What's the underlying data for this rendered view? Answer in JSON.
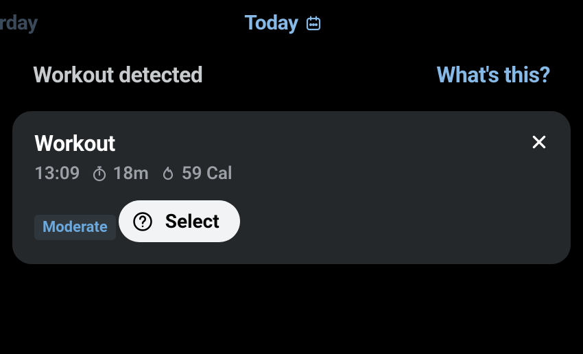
{
  "tabs": {
    "prev_visible_label": "sterday",
    "current_label": "Today"
  },
  "section": {
    "title": "Workout detected",
    "help_link": "What's this?"
  },
  "card": {
    "title": "Workout",
    "time": "13:09",
    "duration": "18m",
    "calories": "59 Cal",
    "tag": "Moderate",
    "select_label": "Select"
  }
}
